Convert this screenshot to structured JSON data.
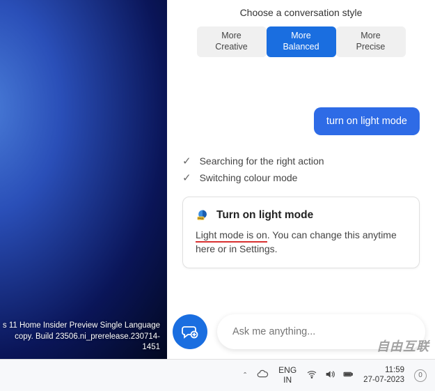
{
  "desktop": {
    "watermark_line1": "s 11 Home Insider Preview Single Language",
    "watermark_line2": "copy. Build 23506.ni_prerelease.230714-1451"
  },
  "chat": {
    "style_title": "Choose a conversation style",
    "styles": {
      "creative_l1": "More",
      "creative_l2": "Creative",
      "balanced_l1": "More",
      "balanced_l2": "Balanced",
      "precise_l1": "More",
      "precise_l2": "Precise"
    },
    "user_message": "turn on light mode",
    "status1": "Searching for the right action",
    "status2": "Switching colour mode",
    "card": {
      "title": "Turn on light mode",
      "underlined": "Light mode is on",
      "rest": ". You can change this anytime here or in Settings."
    },
    "input_placeholder": "Ask me anything..."
  },
  "taskbar": {
    "lang_line1": "ENG",
    "lang_line2": "IN",
    "time": "11:59",
    "date": "27-07-2023",
    "notif_count": "0"
  },
  "overlay_watermark": "自由互联"
}
